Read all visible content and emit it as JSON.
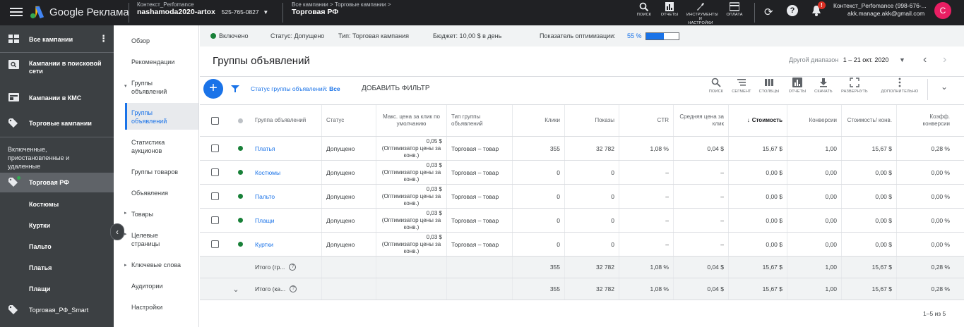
{
  "app": {
    "brand": "Google Реклама"
  },
  "account": {
    "manager": "Контекст_Perfomance",
    "name": "nashamoda2020-artox",
    "id": "525-765-0827"
  },
  "breadcrumb": {
    "path": "Все кампании  >  Торговые кампании  >",
    "current": "Торговая РФ"
  },
  "tools": [
    {
      "label": "ПОИСК",
      "icon": "search-icon"
    },
    {
      "label": "ОТЧЕТЫ",
      "icon": "reports-icon"
    },
    {
      "label": "ИНСТРУМЕНТЫ И НАСТРОЙКИ",
      "icon": "wrench-icon"
    },
    {
      "label": "ОПЛАТА",
      "icon": "credit-card-icon"
    }
  ],
  "user": {
    "name": "Контекст_Perfomance (998-676-...",
    "email": "akk.manage.akk@gmail.com",
    "initial": "C",
    "notif": "!"
  },
  "leftnav": {
    "all_campaigns": "Все кампании",
    "items": [
      {
        "label": "Кампании в поисковой сети",
        "icon": "search-campaign-icon"
      },
      {
        "label": "Кампании в КМС",
        "icon": "display-campaign-icon"
      },
      {
        "label": "Торговые кампании",
        "icon": "shopping-tag-icon"
      }
    ],
    "filter_label": "Включенные, приостановленные и удаленные",
    "campaign": "Торговая РФ",
    "groups": [
      "Костюмы",
      "Куртки",
      "Пальто",
      "Платья",
      "Плащи"
    ],
    "campaign2": "Торговая_РФ_Smart"
  },
  "midnav": {
    "items": [
      "Обзор",
      "Рекомендации",
      "Группы объявлений",
      "Группы объявлений",
      "Статистика аукционов",
      "Группы товаров",
      "Объявления",
      "Товары",
      "Целевые страницы",
      "Ключевые слова",
      "Аудитории",
      "Настройки"
    ]
  },
  "status": {
    "enabled": "Включено",
    "status": "Статус: Допущено",
    "type": "Тип: Торговая кампания",
    "budget": "Бюджет: 10,00 $ в день",
    "opt_label": "Показатель оптимизации:",
    "opt_value": "55 %",
    "opt_fraction": 0.55
  },
  "page": {
    "title": "Группы объявлений",
    "date_label": "Другой диапазон",
    "date_value": "1 – 21 окт. 2020"
  },
  "filter": {
    "label": "Статус группы объявлений:",
    "value": "Все",
    "add": "ДОБАВИТЬ ФИЛЬТР"
  },
  "toolbar": [
    {
      "label": "ПОИСК",
      "icon": "search-icon"
    },
    {
      "label": "СЕГМЕНТ",
      "icon": "segment-icon"
    },
    {
      "label": "СТОЛБЦЫ",
      "icon": "columns-icon"
    },
    {
      "label": "ОТЧЕТЫ",
      "icon": "reports-icon"
    },
    {
      "label": "СКАЧАТЬ",
      "icon": "download-icon"
    },
    {
      "label": "РАЗВЕРНУТЬ",
      "icon": "expand-icon"
    },
    {
      "label": "ДОПОЛНИТЕЛЬНО",
      "icon": "more-vert-icon"
    }
  ],
  "table": {
    "headers": {
      "group": "Группа объявлений",
      "status": "Статус",
      "maxcpc": "Макс. цена за клик по умолчанию",
      "type": "Тип группы объявлений",
      "clicks": "Клики",
      "impr": "Показы",
      "ctr": "CTR",
      "avgcpc": "Средняя цена за клик",
      "cost": "Стоимость",
      "conv": "Конверсии",
      "costconv": "Стоимость/ конв.",
      "convrate": "Коэфф. конверсии"
    },
    "rows": [
      {
        "group": "Платья",
        "status": "Допущено",
        "bid": "0,05 $",
        "bid_note": "(Оптимизатор цены за конв.)",
        "type": "Торговая – товар",
        "clicks": "355",
        "impr": "32 782",
        "ctr": "1,08 %",
        "avgcpc": "0,04 $",
        "cost": "15,67 $",
        "conv": "1,00",
        "costconv": "15,67 $",
        "convrate": "0,28 %"
      },
      {
        "group": "Костюмы",
        "status": "Допущено",
        "bid": "0,03 $",
        "bid_note": "(Оптимизатор цены за конв.)",
        "type": "Торговая – товар",
        "clicks": "0",
        "impr": "0",
        "ctr": "–",
        "avgcpc": "–",
        "cost": "0,00 $",
        "conv": "0,00",
        "costconv": "0,00 $",
        "convrate": "0,00 %"
      },
      {
        "group": "Пальто",
        "status": "Допущено",
        "bid": "0,03 $",
        "bid_note": "(Оптимизатор цены за конв.)",
        "type": "Торговая – товар",
        "clicks": "0",
        "impr": "0",
        "ctr": "–",
        "avgcpc": "–",
        "cost": "0,00 $",
        "conv": "0,00",
        "costconv": "0,00 $",
        "convrate": "0,00 %"
      },
      {
        "group": "Плащи",
        "status": "Допущено",
        "bid": "0,03 $",
        "bid_note": "(Оптимизатор цены за конв.)",
        "type": "Торговая – товар",
        "clicks": "0",
        "impr": "0",
        "ctr": "–",
        "avgcpc": "–",
        "cost": "0,00 $",
        "conv": "0,00",
        "costconv": "0,00 $",
        "convrate": "0,00 %"
      },
      {
        "group": "Куртки",
        "status": "Допущено",
        "bid": "0,03 $",
        "bid_note": "(Оптимизатор цены за конв.)",
        "type": "Торговая – товар",
        "clicks": "0",
        "impr": "0",
        "ctr": "–",
        "avgcpc": "–",
        "cost": "0,00 $",
        "conv": "0,00",
        "costconv": "0,00 $",
        "convrate": "0,00 %"
      }
    ],
    "totals": [
      {
        "label": "Итого (гр...",
        "clicks": "355",
        "impr": "32 782",
        "ctr": "1,08 %",
        "avgcpc": "0,04 $",
        "cost": "15,67 $",
        "conv": "1,00",
        "costconv": "15,67 $",
        "convrate": "0,28 %"
      },
      {
        "label": "Итого (ка...",
        "clicks": "355",
        "impr": "32 782",
        "ctr": "1,08 %",
        "avgcpc": "0,04 $",
        "cost": "15,67 $",
        "conv": "1,00",
        "costconv": "15,67 $",
        "convrate": "0,28 %"
      }
    ],
    "pager": "1–5 из 5"
  }
}
